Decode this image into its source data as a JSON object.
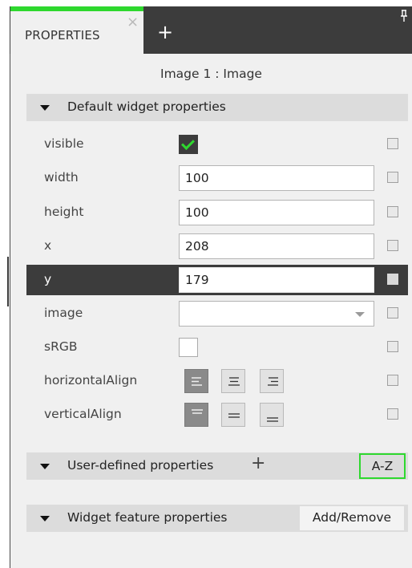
{
  "tabs": {
    "active_label": "PROPERTIES",
    "close_glyph": "×",
    "add_glyph": "+",
    "pin_glyph": "ᵖ",
    "accent_color": "#2ed82e"
  },
  "object_title": "Image 1 : Image",
  "sections": {
    "default": {
      "label": "Default widget properties",
      "expanded": true
    },
    "user_defined": {
      "label": "User-defined properties",
      "add_glyph": "+",
      "sort_label": "A-Z"
    },
    "feature": {
      "label": "Widget feature properties",
      "button_label": "Add/Remove"
    }
  },
  "properties": {
    "visible": {
      "label": "visible",
      "checked": true
    },
    "width": {
      "label": "width",
      "value": "100"
    },
    "height": {
      "label": "height",
      "value": "100"
    },
    "x": {
      "label": "x",
      "value": "208"
    },
    "y": {
      "label": "y",
      "value": "179",
      "selected": true
    },
    "image": {
      "label": "image",
      "value": ""
    },
    "srgb": {
      "label": "sRGB",
      "checked": false
    },
    "horizontal_align": {
      "label": "horizontalAlign",
      "options": [
        "left",
        "center",
        "right"
      ],
      "selected": "left"
    },
    "vertical_align": {
      "label": "verticalAlign",
      "options": [
        "top",
        "middle",
        "bottom"
      ],
      "selected": "top"
    }
  },
  "icons": {
    "section_toggle": "triangle-down-icon",
    "dropdown": "chevron-down-icon",
    "checkmark": "check-icon"
  },
  "colors": {
    "tabbar": "#3c3c3c",
    "panel": "#f0f0f0",
    "section_header": "#dcdcdc",
    "selected_row": "#3c3c3c",
    "accent_green": "#2ed82e"
  }
}
